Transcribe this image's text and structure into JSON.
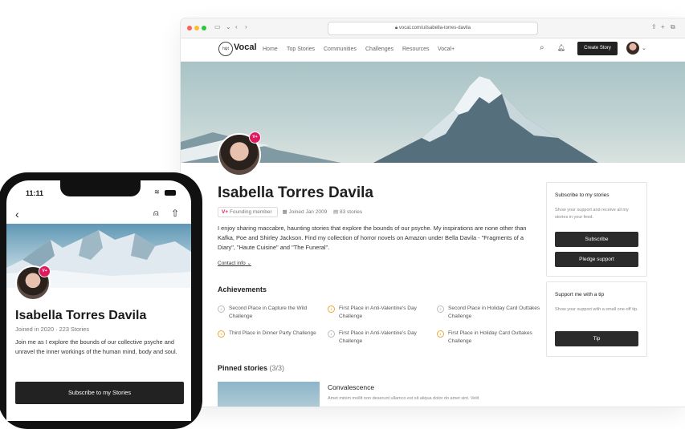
{
  "browser": {
    "url": "vocal.com/u/isabella-torres-davila"
  },
  "nav": {
    "logo_mark": "hψt",
    "logo": "Vocal",
    "links": [
      "Home",
      "Top Stories",
      "Communities",
      "Challenges",
      "Resources",
      "Vocal+"
    ],
    "create_label": "Create Story"
  },
  "profile": {
    "badge": "V+",
    "name": "Isabella Torres Davila",
    "founding": "Founding member",
    "joined": "Joined Jan 2009",
    "stories": "83 stories",
    "bio": "I enjoy sharing maccabre, haunting stories that explore the bounds of our psyche. My inspirations are none other than Kafka, Poe and Shirley Jackson. Find my collection of horror novels on Amazon under Bella Davila - \"Fragments of a Diary\", \"Haute Cuisine\" and \"The Funeral\".",
    "contact": "Contact info"
  },
  "achievements": {
    "title": "Achievements",
    "items": [
      {
        "place": "2",
        "text": "Second Place in Capture the Wild Challenge",
        "tier": "silver"
      },
      {
        "place": "1",
        "text": "First Place in Anti-Valentine's Day Challenge",
        "tier": "gold"
      },
      {
        "place": "2",
        "text": "Second Place in Holiday Card Outtakes Challenge",
        "tier": "silver"
      },
      {
        "place": "3",
        "text": "Third Place in Dinner Party Challenge",
        "tier": "gold"
      },
      {
        "place": "1",
        "text": "First Place in Anti-Valentine's Day Challenge",
        "tier": "silver"
      },
      {
        "place": "1",
        "text": "First Place in Holiday Card Outtakes Challenge",
        "tier": "gold"
      }
    ]
  },
  "pinned": {
    "title": "Pinned stories",
    "count": "(3/3)",
    "story_title": "Convalescence",
    "story_desc": "Amet minim mollit non deserunt ullamco est sit aliqua dolor do amet sint. Velit"
  },
  "subscribe_card": {
    "title": "Subscribe to my stories",
    "text": "Show your support and receive all my stories in your feed.",
    "subscribe": "Subscribe",
    "pledge": "Pledge support"
  },
  "tip_card": {
    "title": "Support me with a tip",
    "text": "Show your support with a small one-off tip.",
    "tip": "Tip"
  },
  "phone": {
    "time": "11:11",
    "name": "Isabella Torres Davila",
    "meta": "Joined in 2020 · 223 Stories",
    "bio": "Join me as I explore the bounds of our collective psyche and unravel the inner workings of the human mind, body and soul.",
    "button": "Subscribe to my Stories"
  },
  "colors": {
    "accent": "#e0195f",
    "dark": "#222222",
    "gold": "#f0a830"
  }
}
